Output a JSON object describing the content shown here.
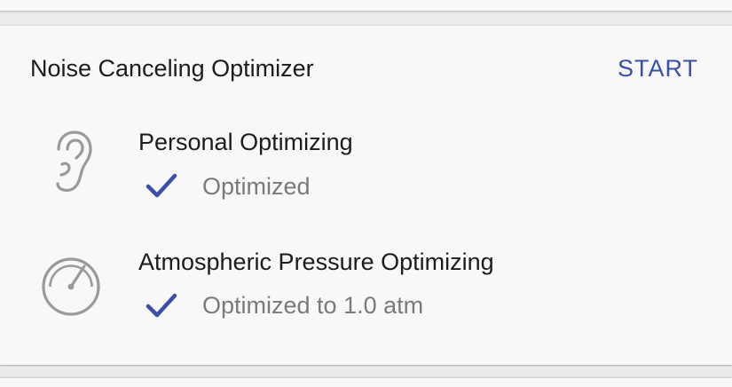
{
  "card": {
    "title": "Noise Canceling Optimizer",
    "start_label": "START"
  },
  "items": [
    {
      "icon": "ear-icon",
      "title": "Personal Optimizing",
      "status_icon": "check-icon",
      "status": "Optimized"
    },
    {
      "icon": "pressure-gauge-icon",
      "title": "Atmospheric Pressure Optimizing",
      "status_icon": "check-icon",
      "status": "Optimized to 1.0 atm"
    }
  ],
  "colors": {
    "accent": "#3a4fa8",
    "primary_text": "#1c1c1c",
    "secondary_text": "#7a7a7a",
    "icon_gray": "#9a9a9a",
    "card_background": "#f8f8f8",
    "page_background": "#ebebeb"
  }
}
